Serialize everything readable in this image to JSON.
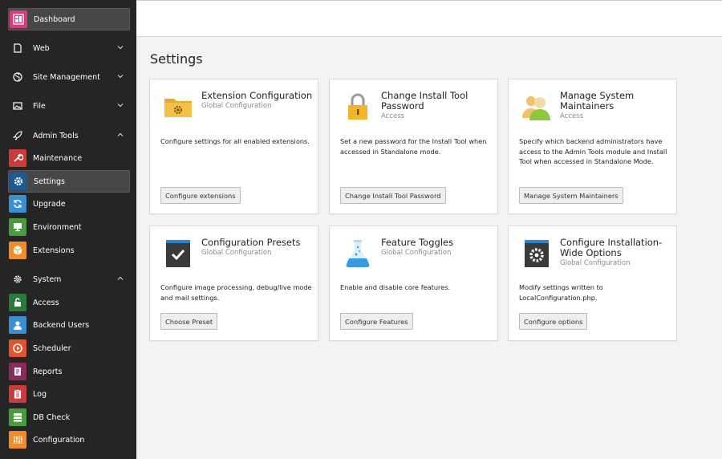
{
  "sidebar": {
    "dashboard": "Dashboard",
    "web": "Web",
    "site_management": "Site Management",
    "file": "File",
    "admin_tools": "Admin Tools",
    "maintenance": "Maintenance",
    "settings": "Settings",
    "upgrade": "Upgrade",
    "environment": "Environment",
    "extensions": "Extensions",
    "system": "System",
    "access": "Access",
    "backend_users": "Backend Users",
    "scheduler": "Scheduler",
    "reports": "Reports",
    "log": "Log",
    "db_check": "DB Check",
    "configuration": "Configuration"
  },
  "main": {
    "title": "Settings",
    "cards": [
      {
        "title": "Extension Configuration",
        "subtitle": "Global Configuration",
        "description": "Configure settings for all enabled extensions.",
        "button": "Configure extensions",
        "icon": "folder-gear-icon"
      },
      {
        "title": "Change Install Tool Password",
        "subtitle": "Access",
        "description": "Set a new password for the Install Tool when accessed in Standalone mode.",
        "button": "Change Install Tool Password",
        "icon": "padlock-icon"
      },
      {
        "title": "Manage System Maintainers",
        "subtitle": "Access",
        "description": "Specify which backend administrators have access to the Admin Tools module and Install Tool when accessed in Standalone Mode.",
        "button": "Manage System Maintainers",
        "icon": "users-icon"
      },
      {
        "title": "Configuration Presets",
        "subtitle": "Global Configuration",
        "description": "Configure image processing, debug/live mode and mail settings.",
        "button": "Choose Preset",
        "icon": "checkmark-doc-icon"
      },
      {
        "title": "Feature Toggles",
        "subtitle": "Global Configuration",
        "description": "Enable and disable core features.",
        "button": "Configure Features",
        "icon": "flask-icon"
      },
      {
        "title": "Configure Installation-Wide Options",
        "subtitle": "Global Configuration",
        "description": "Modify settings written to LocalConfiguration.php.",
        "button": "Configure options",
        "icon": "gear-doc-icon"
      }
    ]
  },
  "colors": {
    "sidebar_bg": "#252525",
    "dashboard": "#d63c7f",
    "maintenance": "#c83c3c",
    "settings": "#1b5a93",
    "upgrade": "#3a8ed2",
    "environment": "#4a9a3f",
    "extensions": "#f08d2b",
    "access": "#2b7a3b",
    "backend_users": "#3a8ed2",
    "scheduler": "#e2542c",
    "reports": "#8a2b5c",
    "log": "#c83c3c",
    "db_check": "#4a9a3f",
    "configuration": "#f08d2b"
  }
}
